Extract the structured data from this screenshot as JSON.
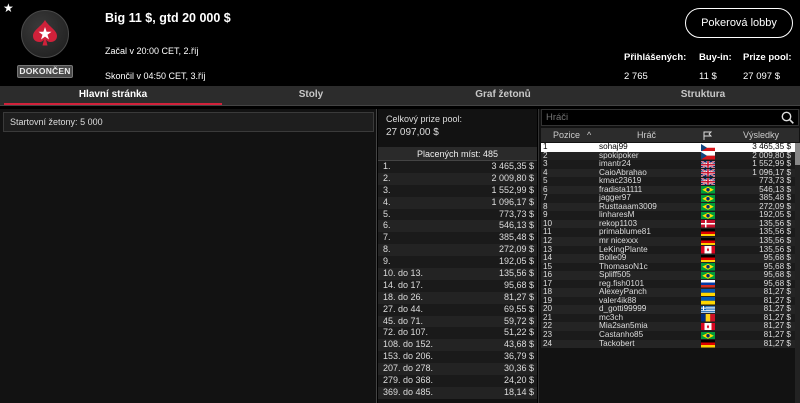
{
  "header": {
    "title": "Big 11 $, gtd 20 000 $",
    "started": "Začal v 20:00 CET, 2.říj",
    "ended": "Skončil v 04:50 CET, 3.říj",
    "status": "DOKONČEN",
    "lobby_button": "Pokerová lobby",
    "stats": [
      {
        "label": "Přihlášených:",
        "value": "2 765"
      },
      {
        "label": "Buy-in:",
        "value": "11 $"
      },
      {
        "label": "Prize pool:",
        "value": "27 097 $"
      }
    ]
  },
  "tabs": [
    "Hlavní stránka",
    "Stoly",
    "Graf žetonů",
    "Struktura"
  ],
  "left": {
    "starting_chips_label": "Startovní žetony:",
    "starting_chips_value": "5 000"
  },
  "middle": {
    "prize_pool_label": "Celkový prize pool:",
    "prize_pool_value": "27 097,00 $",
    "paid_places": "Placených míst: 485",
    "payouts": [
      [
        "1.",
        "3 465,35 $"
      ],
      [
        "2.",
        "2 009,80 $"
      ],
      [
        "3.",
        "1 552,99 $"
      ],
      [
        "4.",
        "1 096,17 $"
      ],
      [
        "5.",
        "773,73 $"
      ],
      [
        "6.",
        "546,13 $"
      ],
      [
        "7.",
        "385,48 $"
      ],
      [
        "8.",
        "272,09 $"
      ],
      [
        "9.",
        "192,05 $"
      ],
      [
        "10. do 13.",
        "135,56 $"
      ],
      [
        "14. do 17.",
        "95,68 $"
      ],
      [
        "18. do 26.",
        "81,27 $"
      ],
      [
        "27. do 44.",
        "69,55 $"
      ],
      [
        "45. do 71.",
        "59,72 $"
      ],
      [
        "72. do 107.",
        "51,22 $"
      ],
      [
        "108. do 152.",
        "43,68 $"
      ],
      [
        "153. do 206.",
        "36,79 $"
      ],
      [
        "207. do 278.",
        "30,36 $"
      ],
      [
        "279. do 368.",
        "24,20 $"
      ],
      [
        "369. do 485.",
        "18,14 $"
      ]
    ]
  },
  "right": {
    "search_placeholder": "Hráči",
    "col_position": "Pozice",
    "col_player": "Hráč",
    "col_results": "Výsledky",
    "players": [
      [
        "1",
        "sohaj99",
        "cz",
        "3 465,35 $"
      ],
      [
        "2",
        "spokipoker",
        "cz",
        "2 009,80 $"
      ],
      [
        "3",
        "imantr24",
        "gb",
        "1 552,99 $"
      ],
      [
        "4",
        "CaioAbrahao",
        "gb",
        "1 096,17 $"
      ],
      [
        "5",
        "kmac23619",
        "gb",
        "773,73 $"
      ],
      [
        "6",
        "fradista1111",
        "br",
        "546,13 $"
      ],
      [
        "7",
        "jagger97",
        "br",
        "385,48 $"
      ],
      [
        "8",
        "Rusttaaam3009",
        "br",
        "272,09 $"
      ],
      [
        "9",
        "linharesM",
        "br",
        "192,05 $"
      ],
      [
        "10",
        "rekop1103",
        "dk",
        "135,56 $"
      ],
      [
        "11",
        "primablume81",
        "de",
        "135,56 $"
      ],
      [
        "12",
        "mr nicexxx",
        "de",
        "135,56 $"
      ],
      [
        "13",
        "LeKingPlante",
        "ca",
        "135,56 $"
      ],
      [
        "14",
        "Bolle09",
        "de",
        "95,68 $"
      ],
      [
        "15",
        "ThomasoN1c",
        "br",
        "95,68 $"
      ],
      [
        "16",
        "Spliff505",
        "br",
        "95,68 $"
      ],
      [
        "17",
        "reg.fish0101",
        "ru",
        "95,68 $"
      ],
      [
        "18",
        "AlexeyPanch",
        "ua",
        "81,27 $"
      ],
      [
        "19",
        "valer4ik88",
        "ua",
        "81,27 $"
      ],
      [
        "20",
        "d_gotti99999",
        "gr",
        "81,27 $"
      ],
      [
        "21",
        "mc3ch",
        "ro",
        "81,27 $"
      ],
      [
        "22",
        "Mia2san5mia",
        "ca",
        "81,27 $"
      ],
      [
        "23",
        "Castanho85",
        "br",
        "81,27 $"
      ],
      [
        "24",
        "Tackobert",
        "de",
        "81,27 $"
      ]
    ]
  },
  "colors": {
    "accent": "#d0213a",
    "background": "#000000"
  }
}
